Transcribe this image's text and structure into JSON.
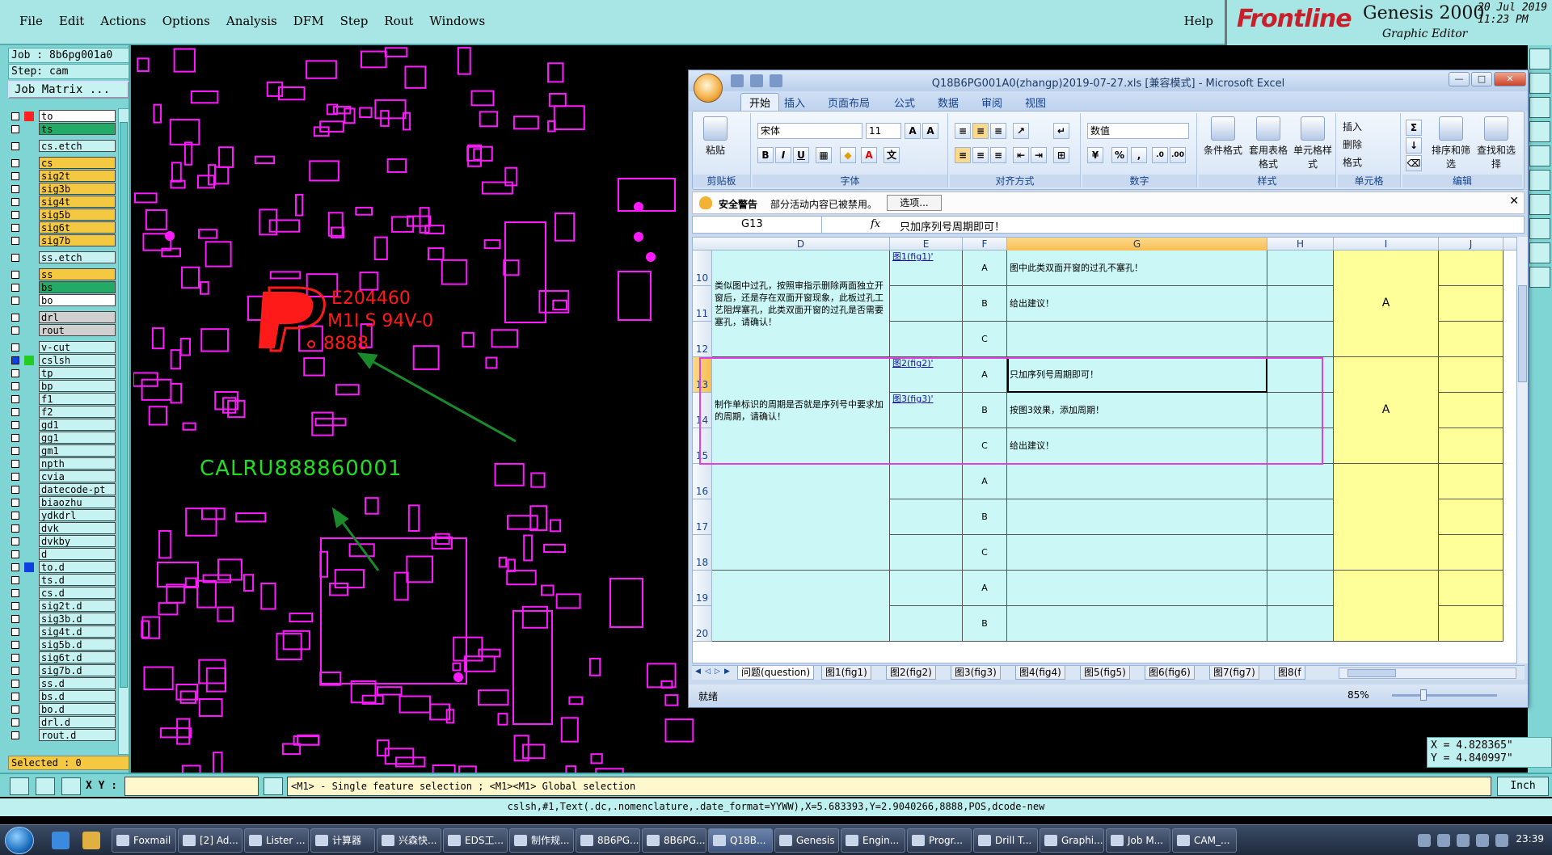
{
  "genesis": {
    "menus": [
      "File",
      "Edit",
      "Actions",
      "Options",
      "Analysis",
      "DFM",
      "Step",
      "Rout",
      "Windows"
    ],
    "help": "Help",
    "brand": "Frontline",
    "product": "Genesis 2000",
    "subtitle": "Graphic Editor",
    "date": "20 Jul 2019",
    "time": "11:23 PM",
    "job": "Job : 8b6pg001a0",
    "step": "Step: cam",
    "job_matrix_label": "Job Matrix ...",
    "selected": "Selected : 0",
    "layers": [
      {
        "name": "to",
        "color": "#ffffff",
        "flag": "#ff2020"
      },
      {
        "name": "ts",
        "color": "#22aa66",
        "flag": ""
      },
      {
        "name": "cs.etch",
        "color": "#c6f2f2",
        "flag": ""
      },
      {
        "name": "cs",
        "color": "#f5c842",
        "flag": ""
      },
      {
        "name": "sig2t",
        "color": "#f5c842",
        "flag": ""
      },
      {
        "name": "sig3b",
        "color": "#f5c842",
        "flag": ""
      },
      {
        "name": "sig4t",
        "color": "#f5c842",
        "flag": ""
      },
      {
        "name": "sig5b",
        "color": "#f5c842",
        "flag": ""
      },
      {
        "name": "sig6t",
        "color": "#f5c842",
        "flag": ""
      },
      {
        "name": "sig7b",
        "color": "#f5c842",
        "flag": ""
      },
      {
        "name": "ss.etch",
        "color": "#c6f2f2",
        "flag": ""
      },
      {
        "name": "ss",
        "color": "#f5c842",
        "flag": ""
      },
      {
        "name": "bs",
        "color": "#22aa66",
        "flag": ""
      },
      {
        "name": "bo",
        "color": "#ffffff",
        "flag": ""
      },
      {
        "name": "drl",
        "color": "#d0d0d0",
        "flag": ""
      },
      {
        "name": "rout",
        "color": "#d0d0d0",
        "flag": ""
      },
      {
        "name": "v-cut",
        "color": "#c6f2f2",
        "flag": ""
      },
      {
        "name": "cslsh",
        "color": "#c6f2f2",
        "flag": "#22cc22",
        "selected": true
      },
      {
        "name": "tp",
        "color": "#c6f2f2",
        "flag": ""
      },
      {
        "name": "bp",
        "color": "#c6f2f2",
        "flag": ""
      },
      {
        "name": "f1",
        "color": "#c6f2f2",
        "flag": ""
      },
      {
        "name": "f2",
        "color": "#c6f2f2",
        "flag": ""
      },
      {
        "name": "gd1",
        "color": "#c6f2f2",
        "flag": ""
      },
      {
        "name": "gg1",
        "color": "#c6f2f2",
        "flag": ""
      },
      {
        "name": "gm1",
        "color": "#c6f2f2",
        "flag": ""
      },
      {
        "name": "npth",
        "color": "#c6f2f2",
        "flag": ""
      },
      {
        "name": "cvia",
        "color": "#c6f2f2",
        "flag": ""
      },
      {
        "name": "datecode-pt",
        "color": "#c6f2f2",
        "flag": ""
      },
      {
        "name": "biaozhu",
        "color": "#c6f2f2",
        "flag": ""
      },
      {
        "name": "ydkdrl",
        "color": "#c6f2f2",
        "flag": ""
      },
      {
        "name": "dvk",
        "color": "#c6f2f2",
        "flag": ""
      },
      {
        "name": "dvkby",
        "color": "#c6f2f2",
        "flag": ""
      },
      {
        "name": "d",
        "color": "#c6f2f2",
        "flag": ""
      },
      {
        "name": "to.d",
        "color": "#c6f2f2",
        "flag": "#1040e0"
      },
      {
        "name": "ts.d",
        "color": "#c6f2f2",
        "flag": ""
      },
      {
        "name": "cs.d",
        "color": "#c6f2f2",
        "flag": ""
      },
      {
        "name": "sig2t.d",
        "color": "#c6f2f2",
        "flag": ""
      },
      {
        "name": "sig3b.d",
        "color": "#c6f2f2",
        "flag": ""
      },
      {
        "name": "sig4t.d",
        "color": "#c6f2f2",
        "flag": ""
      },
      {
        "name": "sig5b.d",
        "color": "#c6f2f2",
        "flag": ""
      },
      {
        "name": "sig6t.d",
        "color": "#c6f2f2",
        "flag": ""
      },
      {
        "name": "sig7b.d",
        "color": "#c6f2f2",
        "flag": ""
      },
      {
        "name": "ss.d",
        "color": "#c6f2f2",
        "flag": ""
      },
      {
        "name": "bs.d",
        "color": "#c6f2f2",
        "flag": ""
      },
      {
        "name": "bo.d",
        "color": "#c6f2f2",
        "flag": ""
      },
      {
        "name": "drl.d",
        "color": "#c6f2f2",
        "flag": ""
      },
      {
        "name": "rout.d",
        "color": "#c6f2f2",
        "flag": ""
      }
    ],
    "canvas_labels": {
      "ul_code": "E204460",
      "ul_grade": "M1I S 94V-0",
      "ul_date": "8888",
      "serial": "CALRU888860001"
    },
    "coords": {
      "x": "X = 4.828365\"",
      "y": "Y = 4.840997\""
    },
    "xy_label": "X Y :",
    "xy_value": "",
    "hint": "<M1> - Single feature selection ; <M1><M1> Global selection",
    "units": "Inch",
    "status": "cslsh,#1,Text(.dc,.nomenclature,.date_format=YYWW),X=5.683393,Y=2.9040266,8888,POS,dcode-new"
  },
  "excel": {
    "title": "Q18B6PG001A0(zhangp)2019-07-27.xls  [兼容模式] - Microsoft Excel",
    "tabs": [
      "开始",
      "插入",
      "页面布局",
      "公式",
      "数据",
      "审阅",
      "视图"
    ],
    "ribbon": {
      "paste": "粘贴",
      "clipboard": "剪贴板",
      "font_name": "宋体",
      "font_size": "11",
      "font_group": "字体",
      "align_group": "对齐方式",
      "number_format": "数值",
      "number_group": "数字",
      "cond_format": "条件格式",
      "table_format": "套用表格格式",
      "cell_style": "单元格样式",
      "style_group": "样式",
      "insert": "插入",
      "delete": "删除",
      "format": "格式",
      "cells_group": "单元格",
      "sort_filter": "排序和筛选",
      "find_select": "查找和选择",
      "edit_group": "编辑"
    },
    "security": {
      "title": "安全警告",
      "message": "部分活动内容已被禁用。",
      "options": "选项..."
    },
    "name_box": "G13",
    "fx": "fx",
    "formula": "只加序列号周期即可！",
    "columns": [
      "D",
      "E",
      "F",
      "G",
      "H",
      "I",
      "J"
    ],
    "rows": [
      "10",
      "11",
      "12",
      "13",
      "14",
      "15",
      "16",
      "17",
      "18",
      "19",
      "20"
    ],
    "q1": "类似图中过孔，按照审指示删除两面独立开窗后，还是存在双面开窗现象，此板过孔工艺阻焊塞孔，此类双面开窗的过孔是否需要塞孔，请确认！",
    "q1_link": "图1(fig1)'",
    "q1_opts": [
      {
        "key": "A",
        "text": "图中此类双面开窗的过孔不塞孔！"
      },
      {
        "key": "B",
        "text": "给出建议！"
      },
      {
        "key": "C",
        "text": ""
      }
    ],
    "q1_answer": "A",
    "q2": "制作单标识的周期是否就是序列号中要求加的周期，请确认！",
    "q2_link1": "图2(fig2)'",
    "q2_link2": "图3(fig3)'",
    "q2_opts": [
      {
        "key": "A",
        "text": "只加序列号周期即可！"
      },
      {
        "key": "B",
        "text": "按图3效果，添加周期！"
      },
      {
        "key": "C",
        "text": "给出建议！"
      }
    ],
    "q2_answer": "A",
    "q3_opts": [
      "A",
      "B",
      "C"
    ],
    "q4_opts": [
      "A",
      "B"
    ],
    "sheets": [
      "问题(question)",
      "图1(fig1)",
      "图2(fig2)",
      "图3(fig3)",
      "图4(fig4)",
      "图5(fig5)",
      "图6(fig6)",
      "图7(fig7)",
      "图8(f"
    ],
    "ready": "就绪",
    "zoom": "85%"
  },
  "taskbar": {
    "items": [
      "Foxmail",
      "[2] Ad...",
      "Lister ...",
      "计算器",
      "兴森快...",
      "EDS工...",
      "制作规...",
      "8B6PG...",
      "8B6PG...",
      "Q18B...",
      "Genesis",
      "Engin...",
      "Progr...",
      "Drill T...",
      "Graphi...",
      "Job M...",
      "CAM_..."
    ],
    "active": "Q18B...",
    "clock": "23:39"
  },
  "colors": {
    "genesis_panel": "#7fd4d4",
    "pcb_features": "#ff1aff",
    "ul_mark": "#ff1a1a",
    "serial_text": "#22dd22",
    "highlight": "#e040e0"
  }
}
